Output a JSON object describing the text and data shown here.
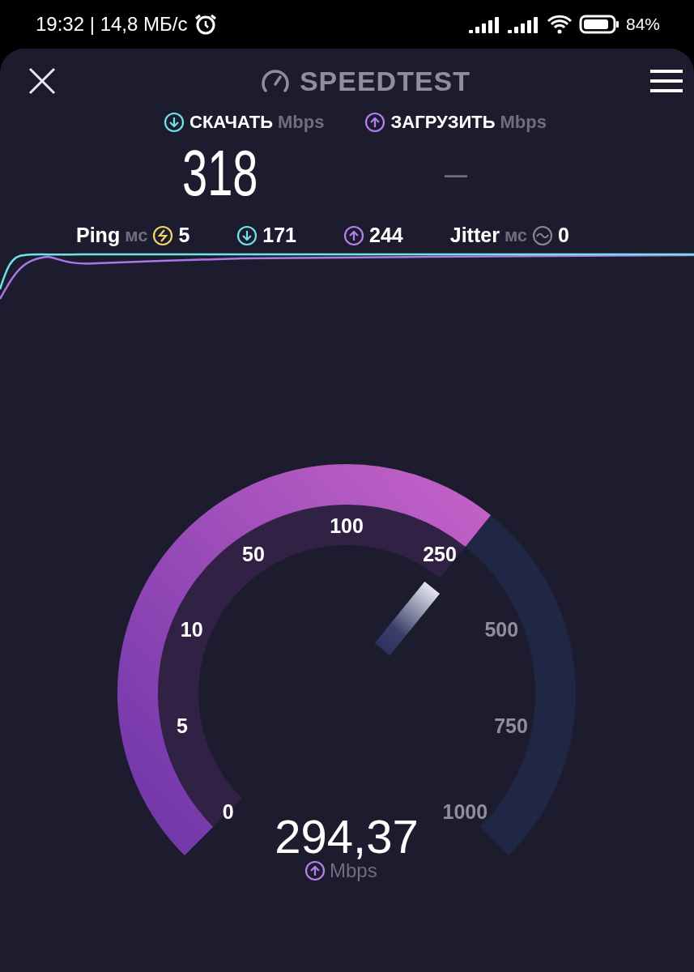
{
  "status_bar": {
    "time": "19:32 | 14,8 МБ/с",
    "battery": "84%"
  },
  "header": {
    "title": "SPEEDTEST"
  },
  "metrics": [
    {
      "kind": "download",
      "label": "СКАЧАТЬ",
      "unit": "Mbps",
      "value": "318"
    },
    {
      "kind": "upload",
      "label": "ЗАГРУЗИТЬ",
      "unit": "Mbps",
      "value": "—"
    }
  ],
  "stats": [
    {
      "kind": "ping",
      "label": "Ping",
      "unit": "мс",
      "value": "5"
    },
    {
      "kind": "download",
      "value": "171"
    },
    {
      "kind": "upload",
      "value": "244"
    },
    {
      "kind": "jitter",
      "label": "Jitter",
      "unit": "мс",
      "value": "0"
    }
  ],
  "gauge": {
    "ticks": [
      {
        "label": "0",
        "reached": true
      },
      {
        "label": "5",
        "reached": true
      },
      {
        "label": "10",
        "reached": true
      },
      {
        "label": "50",
        "reached": true
      },
      {
        "label": "100",
        "reached": true
      },
      {
        "label": "250",
        "reached": true
      },
      {
        "label": "500",
        "reached": false
      },
      {
        "label": "750",
        "reached": false
      },
      {
        "label": "1000",
        "reached": false
      }
    ],
    "readout": {
      "kind": "upload",
      "value": "294,37",
      "unit": "Mbps"
    }
  }
}
